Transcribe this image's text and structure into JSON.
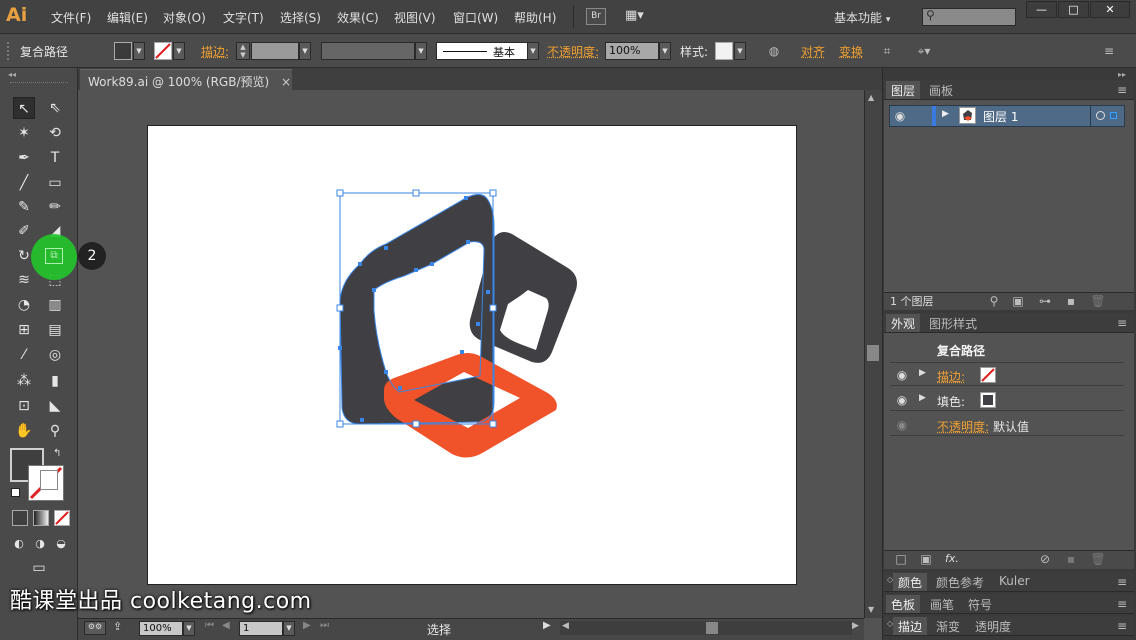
{
  "app": {
    "logo": "Ai"
  },
  "menu": [
    "文件(F)",
    "编辑(E)",
    "对象(O)",
    "文字(T)",
    "选择(S)",
    "效果(C)",
    "视图(V)",
    "窗口(W)",
    "帮助(H)"
  ],
  "topbar": {
    "bridge": "Br",
    "workspace": "基本功能",
    "workspace_arrow": "▾"
  },
  "window_buttons": {
    "minimize": "—",
    "restore": "□",
    "close": "✕"
  },
  "control": {
    "selection_type": "复合路径",
    "stroke_label": "描边:",
    "stroke_profile": "基本",
    "opacity_label": "不透明度:",
    "opacity_value": "100%",
    "style_label": "样式:",
    "align_label": "对齐",
    "transform_label": "变换"
  },
  "document": {
    "tab_title": "Work89.ai @ 100% (RGB/预览)",
    "tab_close": "×"
  },
  "status": {
    "zoom": "100%",
    "artboard_num": "1",
    "tool_name": "选择"
  },
  "callout": {
    "number": "2"
  },
  "layers_panel": {
    "tabs": [
      "图层",
      "画板"
    ],
    "layer_name": "图层 1",
    "count_text": "1 个图层"
  },
  "appearance_panel": {
    "tabs": [
      "外观",
      "图形样式"
    ],
    "title": "复合路径",
    "stroke_label": "描边:",
    "fill_label": "填色:",
    "opacity_label": "不透明度:",
    "opacity_value": "默认值",
    "fx_label": "fx."
  },
  "collapsed_panels": [
    [
      "颜色",
      "颜色参考",
      "Kuler"
    ],
    [
      "色板",
      "画笔",
      "符号"
    ],
    [
      "描边",
      "渐变",
      "透明度"
    ]
  ],
  "watermark": "酷课堂出品 coolketang.com",
  "colors": {
    "orange_accent": "#f0a030",
    "shape_dark": "#404044",
    "shape_orange": "#f0522a",
    "selection_blue": "#3a86e6",
    "callout_green": "#22c52a"
  }
}
